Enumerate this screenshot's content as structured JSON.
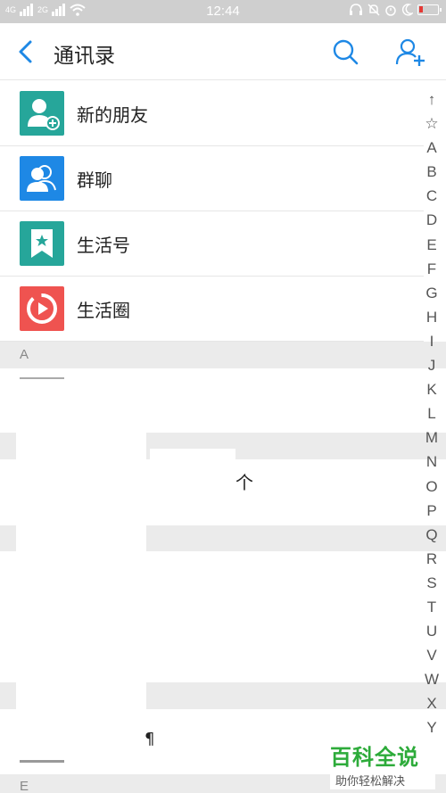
{
  "status_bar": {
    "time": "12:44",
    "sim1": "4G",
    "sim2": "2G"
  },
  "header": {
    "title": "通讯录"
  },
  "rows": [
    {
      "label": "新的朋友",
      "icon": "new-friend-icon",
      "color": "#26a69a"
    },
    {
      "label": "群聊",
      "icon": "group-chat-icon",
      "color": "#1e88e5"
    },
    {
      "label": "生活号",
      "icon": "life-account-icon",
      "color": "#26a69a"
    },
    {
      "label": "生活圈",
      "icon": "life-circle-icon",
      "color": "#ef5350"
    }
  ],
  "sections": [
    {
      "letter": "A"
    },
    {
      "letter": ""
    },
    {
      "letter": ""
    },
    {
      "letter": ""
    },
    {
      "letter": "E"
    }
  ],
  "fragments": {
    "frag1": "个",
    "frag2": "¶"
  },
  "index": [
    "↑",
    "☆",
    "A",
    "B",
    "C",
    "D",
    "E",
    "F",
    "G",
    "H",
    "I",
    "J",
    "K",
    "L",
    "M",
    "N",
    "O",
    "P",
    "Q",
    "R",
    "S",
    "T",
    "U",
    "V",
    "W",
    "X",
    "Y"
  ],
  "watermark": {
    "main": "百科全说",
    "sub": "助你轻松解决"
  },
  "colors": {
    "accent": "#1e88e5",
    "section_bg": "#ebebeb",
    "watermark_green": "#2dab3a"
  }
}
